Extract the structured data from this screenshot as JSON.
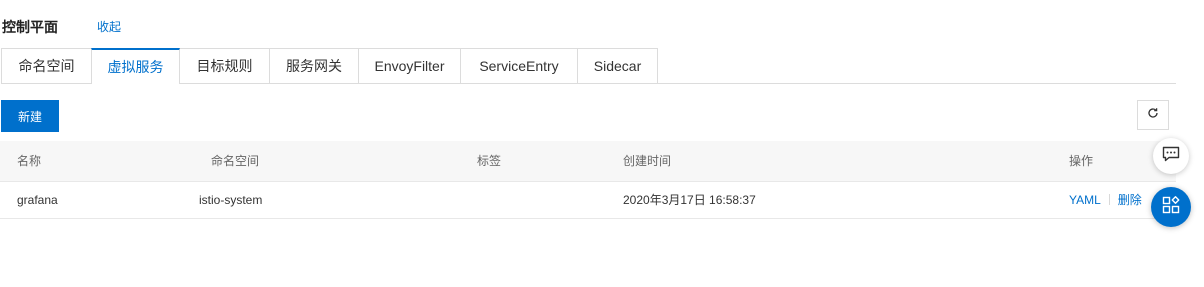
{
  "header": {
    "title": "控制平面",
    "collapse_label": "收起"
  },
  "tabs": [
    {
      "label": "命名空间",
      "active": false
    },
    {
      "label": "虚拟服务",
      "active": true
    },
    {
      "label": "目标规则",
      "active": false
    },
    {
      "label": "服务网关",
      "active": false
    },
    {
      "label": "EnvoyFilter",
      "active": false
    },
    {
      "label": "ServiceEntry",
      "active": false
    },
    {
      "label": "Sidecar",
      "active": false
    }
  ],
  "toolbar": {
    "new_label": "新建",
    "refresh_icon": "refresh-icon"
  },
  "table": {
    "columns": [
      "名称",
      "命名空间",
      "标签",
      "创建时间",
      "操作"
    ],
    "rows": [
      {
        "name": "grafana",
        "namespace": "istio-system",
        "labels": "",
        "created": "2020年3月17日 16:58:37",
        "actions": [
          "YAML",
          "删除"
        ]
      }
    ]
  },
  "floating": {
    "chat_icon": "chat-icon",
    "apps_icon": "apps-icon"
  },
  "colors": {
    "accent": "#0070cc",
    "border": "#dcdcdc",
    "header_bg": "#f7f7f7"
  }
}
